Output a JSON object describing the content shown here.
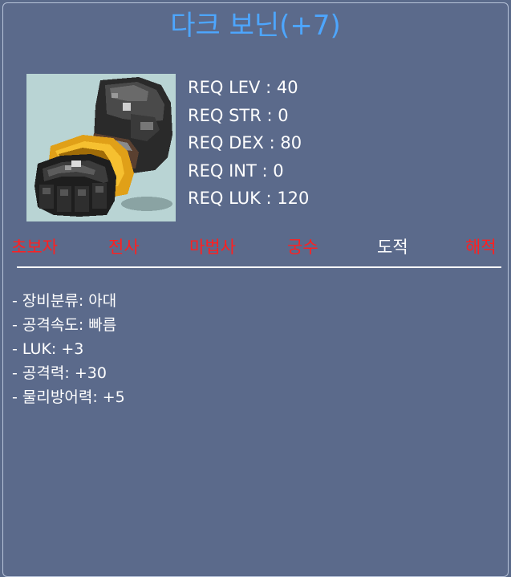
{
  "item": {
    "name": "다크 보닌(+7)",
    "name_color": "#4da6ff"
  },
  "requirements": [
    {
      "label": "REQ LEV",
      "value": "40"
    },
    {
      "label": "REQ STR",
      "value": "0"
    },
    {
      "label": "REQ DEX",
      "value": "80"
    },
    {
      "label": "REQ INT",
      "value": "0"
    },
    {
      "label": "REQ LUK",
      "value": "120"
    }
  ],
  "jobs": [
    {
      "label": "초보자",
      "enabled": false
    },
    {
      "label": "전사",
      "enabled": false
    },
    {
      "label": "마법사",
      "enabled": false
    },
    {
      "label": "궁수",
      "enabled": false
    },
    {
      "label": "도적",
      "enabled": true
    },
    {
      "label": "해적",
      "enabled": false
    }
  ],
  "stats": [
    {
      "label": "장비분류",
      "value": "아대"
    },
    {
      "label": "공격속도",
      "value": "빠름"
    },
    {
      "label": "LUK",
      "value": "+3"
    },
    {
      "label": "공격력",
      "value": "+30"
    },
    {
      "label": "물리방어력",
      "value": "+5"
    }
  ],
  "colors": {
    "background": "#5b6a8b",
    "job_disabled": "#ff2020",
    "job_enabled": "#ffffff"
  },
  "icons": {
    "item": "claw-glove-icon"
  }
}
